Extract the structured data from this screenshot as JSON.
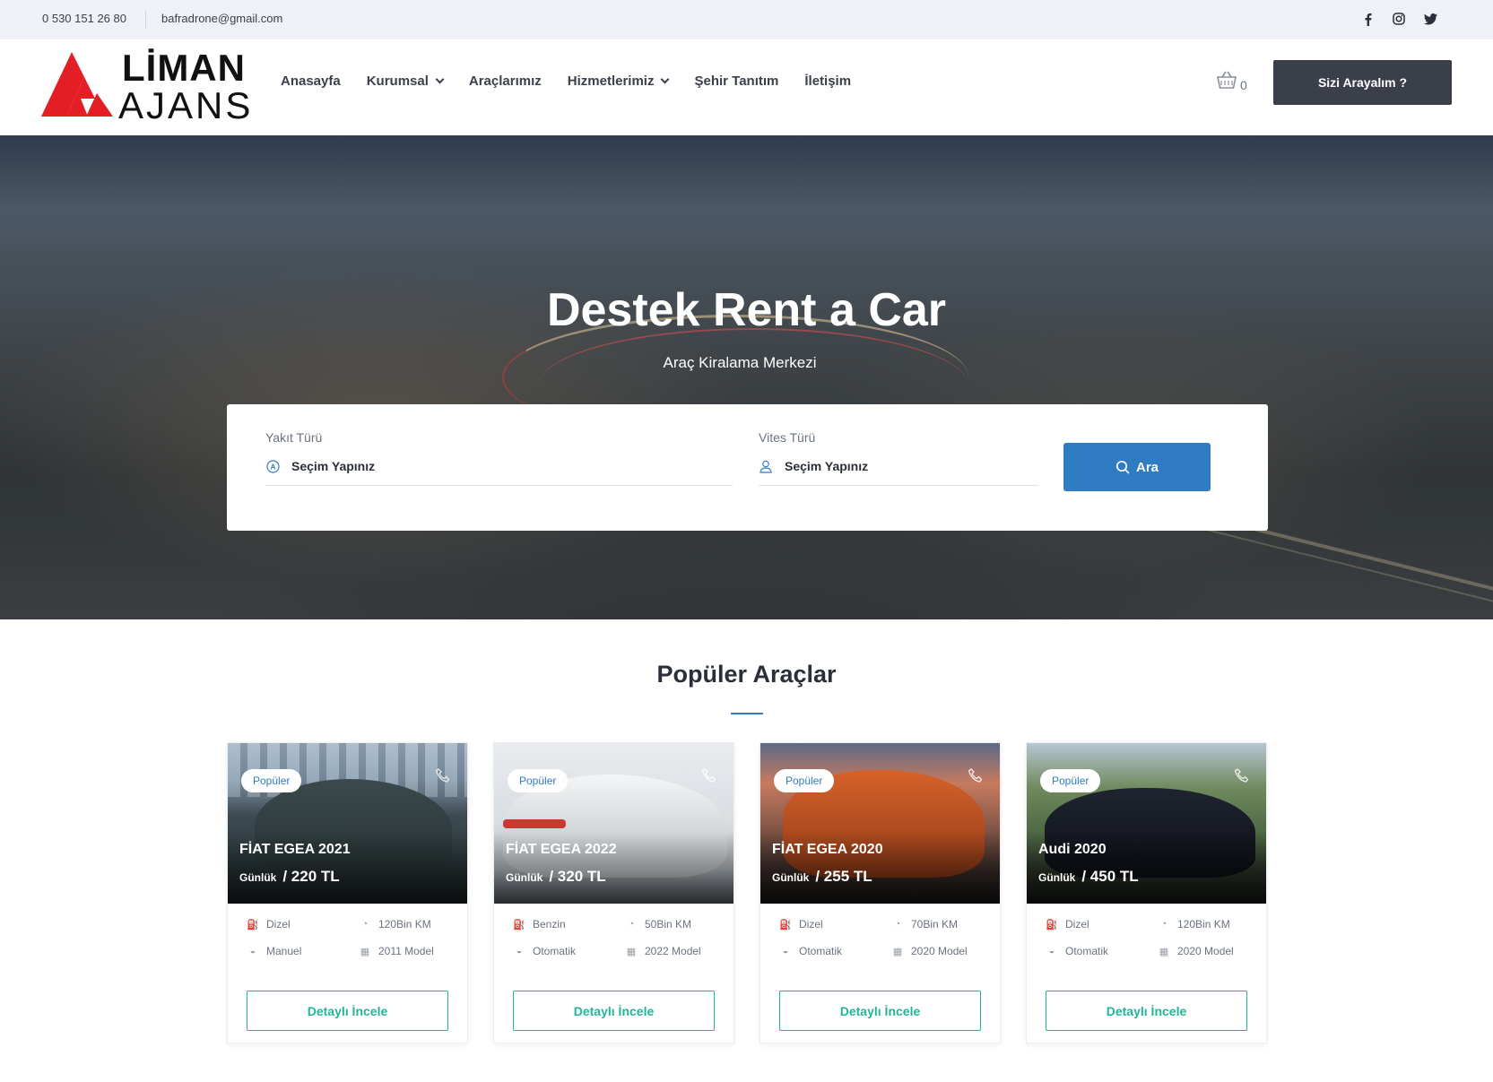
{
  "topbar": {
    "phone": "0 530 151 26 80",
    "email": "bafradrone@gmail.com",
    "social": [
      "facebook-icon",
      "instagram-icon",
      "twitter-icon"
    ]
  },
  "brand": {
    "line1": "LİMAN",
    "line2": "AJANS",
    "accent_color": "#e31e24"
  },
  "nav": {
    "items": [
      "Anasayfa",
      "Kurumsal",
      "Araçlarımız",
      "Hizmetlerimiz",
      "Şehir Tanıtım",
      "İletişim"
    ]
  },
  "cart": {
    "count": "0"
  },
  "header_cta": "Sizi Arayalım ?",
  "hero": {
    "title": "Destek Rent a Car",
    "subtitle": "Araç Kiralama Merkezi"
  },
  "search": {
    "fuel_label": "Yakıt Türü",
    "fuel_value": "Seçim Yapınız",
    "gear_label": "Vites Türü",
    "gear_value": "Seçim Yapınız",
    "button": "Ara",
    "button_color": "#2f7cc3"
  },
  "popular": {
    "title": "Popüler Araçlar",
    "cards": [
      {
        "badge": "Popüler",
        "name": "FİAT EGEA 2021",
        "price_label": "Günlük",
        "price": "/ 220 TL",
        "fuel": "Dizel",
        "km": "120Bin KM",
        "gear": "Manuel",
        "model": "2011 Model",
        "button": "Detaylı İncele"
      },
      {
        "badge": "Popüler",
        "name": "FİAT EGEA 2022",
        "price_label": "Günlük",
        "price": "/ 320 TL",
        "fuel": "Benzin",
        "km": "50Bin KM",
        "gear": "Otomatik",
        "model": "2022 Model",
        "button": "Detaylı İncele"
      },
      {
        "badge": "Popüler",
        "name": "FİAT EGEA 2020",
        "price_label": "Günlük",
        "price": "/ 255 TL",
        "fuel": "Dizel",
        "km": "70Bin KM",
        "gear": "Otomatik",
        "model": "2020 Model",
        "button": "Detaylı İncele"
      },
      {
        "badge": "Popüler",
        "name": "Audi 2020",
        "price_label": "Günlük",
        "price": "/ 450 TL",
        "fuel": "Dizel",
        "km": "120Bin KM",
        "gear": "Otomatik",
        "model": "2020 Model",
        "button": "Detaylı İncele"
      }
    ]
  }
}
